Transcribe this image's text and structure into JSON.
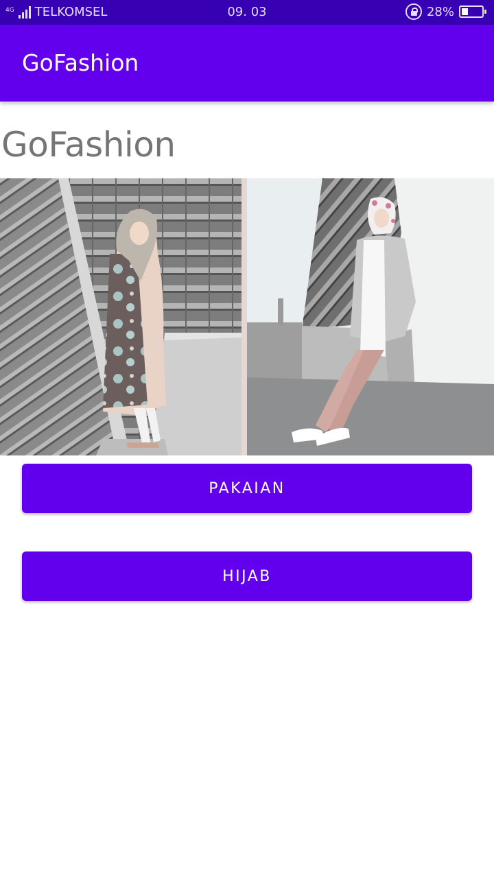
{
  "status_bar": {
    "network_type": "4G",
    "carrier": "TELKOMSEL",
    "time": "09. 03",
    "battery_percent": "28%",
    "battery_level": 0.28,
    "icons": [
      "signal-icon",
      "rotation-lock-icon",
      "battery-icon"
    ]
  },
  "app_bar": {
    "title": "GoFashion",
    "color": "#6200ee"
  },
  "main": {
    "heading": "GoFashion",
    "hero_image": "hijab-fashion-photo",
    "buttons": [
      {
        "label": "PAKAIAN"
      },
      {
        "label": "HIJAB"
      }
    ]
  },
  "colors": {
    "primary": "#6200ee",
    "primary_dark": "#3700b3",
    "heading_text": "#757575"
  }
}
